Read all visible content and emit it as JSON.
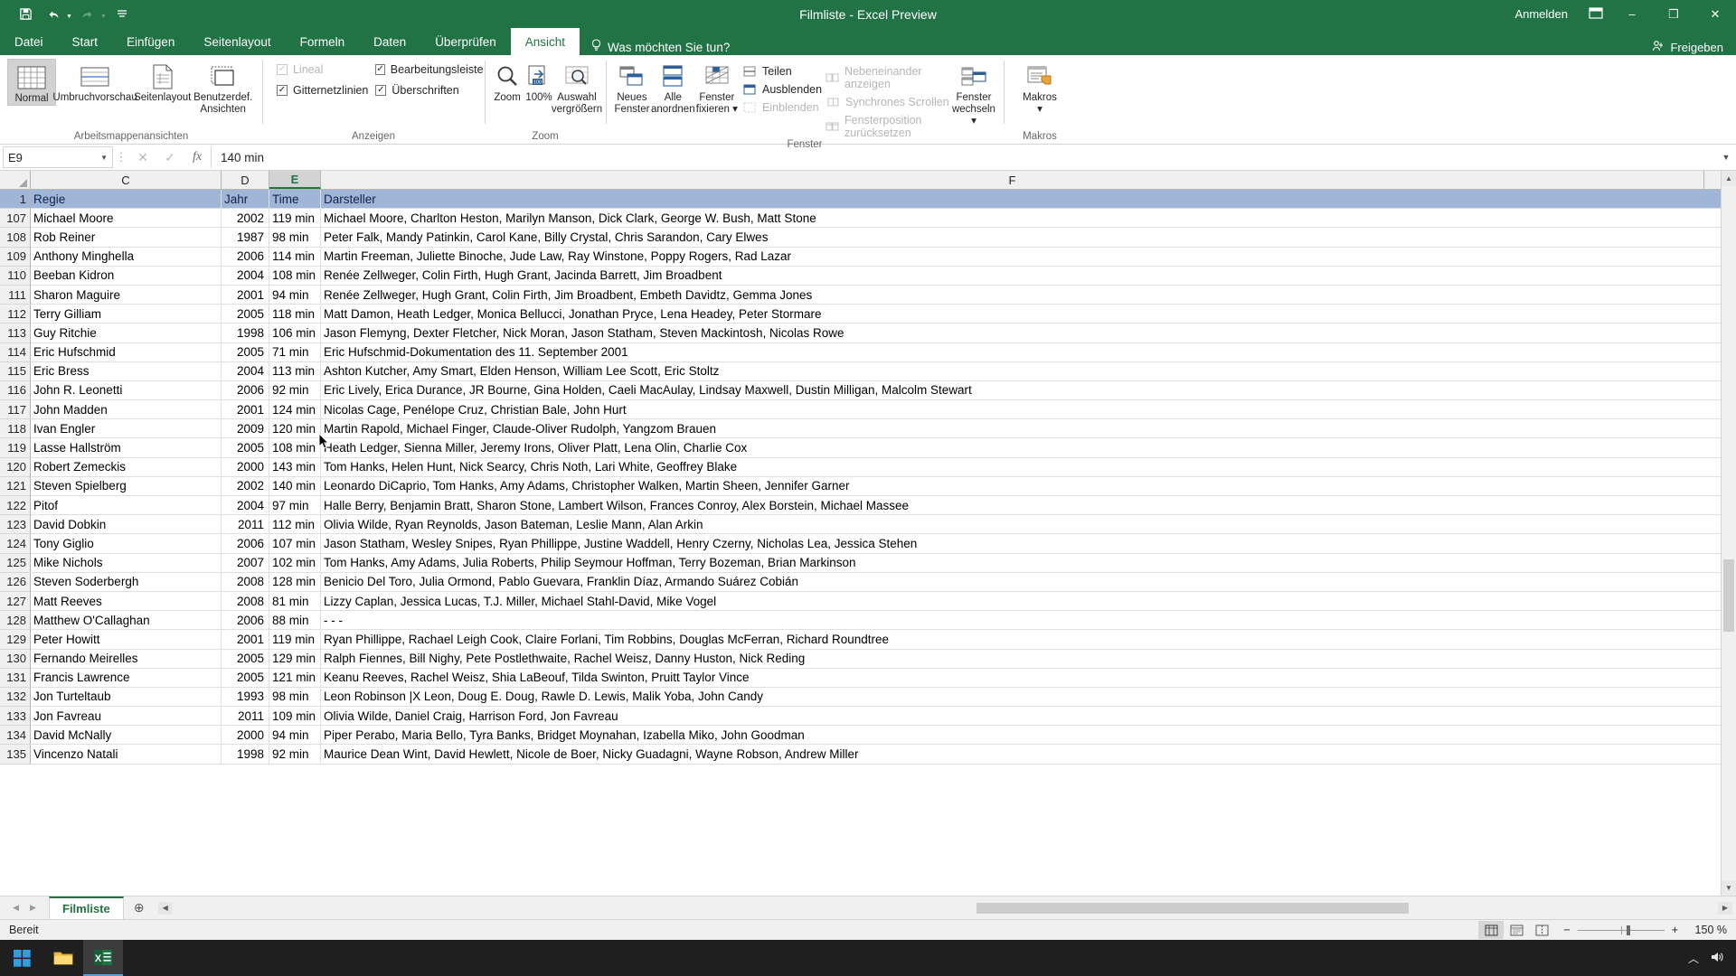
{
  "titlebar": {
    "document_title": "Filmliste - Excel Preview",
    "qat": [
      {
        "name": "save",
        "glyph": "ὋE"
      },
      {
        "name": "undo",
        "glyph": "↶"
      },
      {
        "name": "redo",
        "glyph": "↷"
      },
      {
        "name": "customize",
        "glyph": "≡"
      }
    ],
    "signin_label": "Anmelden",
    "ribbon_display_label": "□",
    "minimize_label": "–",
    "restore_label": "❐",
    "close_label": "✕"
  },
  "tabs": [
    {
      "id": "datei",
      "label": "Datei",
      "active": false
    },
    {
      "id": "start",
      "label": "Start",
      "active": false
    },
    {
      "id": "einfuegen",
      "label": "Einfügen",
      "active": false
    },
    {
      "id": "seitenlayout",
      "label": "Seitenlayout",
      "active": false
    },
    {
      "id": "formeln",
      "label": "Formeln",
      "active": false
    },
    {
      "id": "daten",
      "label": "Daten",
      "active": false
    },
    {
      "id": "ueberpruefen",
      "label": "Überprüfen",
      "active": false
    },
    {
      "id": "ansicht",
      "label": "Ansicht",
      "active": true
    }
  ],
  "tellme": {
    "label": "Was möchten Sie tun?",
    "icon": "lightbulb-icon"
  },
  "share": {
    "label": "Freigeben",
    "icon": "share-person-icon"
  },
  "ribbon": {
    "groups": [
      {
        "id": "arbeitsmappenansichten",
        "label": "Arbeitsmappenansichten",
        "buttons": [
          {
            "id": "normal",
            "label": "Normal",
            "selected": true
          },
          {
            "id": "umbruchvorschau",
            "label": "Umbruchvorschau",
            "selected": false
          },
          {
            "id": "seitenlayout",
            "label": "Seitenlayout",
            "selected": false
          },
          {
            "id": "benutzerdef_ansichten",
            "label": "Benutzerdef.\nAnsichten",
            "selected": false
          }
        ]
      },
      {
        "id": "anzeigen",
        "label": "Anzeigen",
        "checks": [
          {
            "id": "lineal",
            "label": "Lineal",
            "checked": true,
            "disabled": true
          },
          {
            "id": "bearbeitungsleiste",
            "label": "Bearbeitungsleiste",
            "checked": true,
            "disabled": false
          },
          {
            "id": "gitternetzlinien",
            "label": "Gitternetzlinien",
            "checked": true,
            "disabled": false
          },
          {
            "id": "ueberschriften",
            "label": "Überschriften",
            "checked": true,
            "disabled": false
          }
        ]
      },
      {
        "id": "zoom",
        "label": "Zoom",
        "buttons": [
          {
            "id": "zoom",
            "label": "Zoom",
            "selected": false
          },
          {
            "id": "hundert_prozent",
            "label": "100%",
            "selected": false
          },
          {
            "id": "auswahl_vergroessern",
            "label": "Auswahl\nvergrößern",
            "selected": false
          }
        ]
      },
      {
        "id": "fenster",
        "label": "Fenster",
        "buttons": [
          {
            "id": "neues_fenster",
            "label": "Neues\nFenster",
            "selected": false
          },
          {
            "id": "alle_anordnen",
            "label": "Alle\nanordnen",
            "selected": false
          },
          {
            "id": "fenster_fixieren",
            "label": "Fenster\nfixieren ▾",
            "selected": false
          }
        ],
        "checks": [
          {
            "id": "teilen",
            "label": "Teilen",
            "disabled": false
          },
          {
            "id": "ausblenden",
            "label": "Ausblenden",
            "disabled": false
          },
          {
            "id": "einblenden",
            "label": "Einblenden",
            "disabled": true
          }
        ],
        "small_items": [
          {
            "id": "nebeneinander_anzeigen",
            "label": "Nebeneinander anzeigen",
            "disabled": true
          },
          {
            "id": "synchrones_scrollen",
            "label": "Synchrones Scrollen",
            "disabled": true
          },
          {
            "id": "fensterposition_zuruecksetzen",
            "label": "Fensterposition zurücksetzen",
            "disabled": true
          }
        ],
        "end_buttons": [
          {
            "id": "fenster_wechseln",
            "label": "Fenster\nwechseln ▾",
            "selected": false
          }
        ]
      },
      {
        "id": "makros",
        "label": "Makros",
        "buttons": [
          {
            "id": "makros",
            "label": "Makros\n▾",
            "selected": false
          }
        ]
      }
    ]
  },
  "formula_bar": {
    "name_box_value": "E9",
    "cancel_icon": "cancel-icon",
    "confirm_icon": "check-icon",
    "fx_icon": "fx-icon",
    "formula_value": "140 min",
    "expand_icon": "chevron-down-icon"
  },
  "grid": {
    "columns": [
      {
        "id": "C",
        "label": "C",
        "selected": false
      },
      {
        "id": "D",
        "label": "D",
        "selected": false
      },
      {
        "id": "E",
        "label": "E",
        "selected": true
      },
      {
        "id": "F",
        "label": "F",
        "selected": false
      }
    ],
    "header_row": {
      "number": "1",
      "cells": [
        "Regie",
        "Jahr",
        "Time",
        "Darsteller"
      ]
    },
    "rows": [
      {
        "n": "107",
        "c": "Michael Moore",
        "d": "2002",
        "e": "119 min",
        "f": "Michael Moore, Charlton Heston, Marilyn Manson, Dick Clark, George W. Bush, Matt Stone"
      },
      {
        "n": "108",
        "c": "Rob Reiner",
        "d": "1987",
        "e": "98 min",
        "f": "Peter Falk, Mandy Patinkin, Carol Kane, Billy Crystal, Chris Sarandon, Cary Elwes"
      },
      {
        "n": "109",
        "c": "Anthony Minghella",
        "d": "2006",
        "e": "114 min",
        "f": "Martin Freeman, Juliette Binoche, Jude Law, Ray Winstone, Poppy Rogers, Rad Lazar"
      },
      {
        "n": "110",
        "c": "Beeban Kidron",
        "d": "2004",
        "e": "108 min",
        "f": "Renée Zellweger, Colin Firth, Hugh Grant, Jacinda Barrett, Jim Broadbent"
      },
      {
        "n": "111",
        "c": "Sharon Maguire",
        "d": "2001",
        "e": "94 min",
        "f": "Renée Zellweger, Hugh Grant, Colin Firth, Jim Broadbent, Embeth Davidtz, Gemma Jones"
      },
      {
        "n": "112",
        "c": "Terry Gilliam",
        "d": "2005",
        "e": "118 min",
        "f": "Matt Damon, Heath Ledger, Monica Bellucci, Jonathan Pryce, Lena Headey, Peter Stormare"
      },
      {
        "n": "113",
        "c": "Guy Ritchie",
        "d": "1998",
        "e": "106 min",
        "f": "Jason Flemyng, Dexter Fletcher, Nick Moran, Jason Statham, Steven Mackintosh, Nicolas Rowe"
      },
      {
        "n": "114",
        "c": "Eric Hufschmid",
        "d": "2005",
        "e": "71 min",
        "f": "Eric Hufschmid-Dokumentation des 11. September 2001"
      },
      {
        "n": "115",
        "c": "Eric Bress",
        "d": "2004",
        "e": "113 min",
        "f": "Ashton Kutcher, Amy Smart, Elden Henson, William Lee Scott, Eric Stoltz"
      },
      {
        "n": "116",
        "c": "John R. Leonetti",
        "d": "2006",
        "e": "92 min",
        "f": "Eric Lively, Erica Durance, JR Bourne, Gina Holden, Caeli MacAulay, Lindsay Maxwell, Dustin Milligan, Malcolm Stewart"
      },
      {
        "n": "117",
        "c": "John Madden",
        "d": "2001",
        "e": "124 min",
        "f": "Nicolas Cage, Penélope Cruz, Christian Bale, John Hurt"
      },
      {
        "n": "118",
        "c": "Ivan Engler",
        "d": "2009",
        "e": "120 min",
        "f": "Martin Rapold, Michael Finger, Claude-Oliver Rudolph, Yangzom Brauen"
      },
      {
        "n": "119",
        "c": "Lasse Hallström",
        "d": "2005",
        "e": "108 min",
        "f": "Heath Ledger, Sienna Miller, Jeremy Irons, Oliver Platt, Lena Olin, Charlie Cox"
      },
      {
        "n": "120",
        "c": "Robert Zemeckis",
        "d": "2000",
        "e": "143 min",
        "f": "Tom Hanks, Helen Hunt, Nick Searcy, Chris Noth, Lari White, Geoffrey Blake"
      },
      {
        "n": "121",
        "c": "Steven Spielberg",
        "d": "2002",
        "e": "140 min",
        "f": "Leonardo DiCaprio, Tom Hanks, Amy Adams, Christopher Walken, Martin Sheen, Jennifer Garner"
      },
      {
        "n": "122",
        "c": "Pitof",
        "d": "2004",
        "e": "97 min",
        "f": "Halle Berry, Benjamin Bratt, Sharon Stone, Lambert Wilson, Frances Conroy, Alex Borstein, Michael Massee"
      },
      {
        "n": "123",
        "c": "David Dobkin",
        "d": "2011",
        "e": "112 min",
        "f": "Olivia Wilde, Ryan Reynolds, Jason Bateman, Leslie Mann, Alan Arkin"
      },
      {
        "n": "124",
        "c": "Tony Giglio",
        "d": "2006",
        "e": "107 min",
        "f": "Jason Statham, Wesley Snipes, Ryan Phillippe, Justine Waddell, Henry Czerny, Nicholas Lea, Jessica Stehen"
      },
      {
        "n": "125",
        "c": "Mike Nichols",
        "d": "2007",
        "e": "102 min",
        "f": "Tom Hanks, Amy Adams, Julia Roberts, Philip Seymour Hoffman, Terry Bozeman, Brian Markinson"
      },
      {
        "n": "126",
        "c": "Steven Soderbergh",
        "d": "2008",
        "e": "128 min",
        "f": "Benicio Del Toro, Julia Ormond, Pablo Guevara, Franklin Díaz, Armando Suárez Cobián"
      },
      {
        "n": "127",
        "c": "Matt Reeves",
        "d": "2008",
        "e": "81 min",
        "f": "Lizzy Caplan, Jessica Lucas, T.J. Miller, Michael Stahl-David, Mike Vogel"
      },
      {
        "n": "128",
        "c": "Matthew O'Callaghan",
        "d": "2006",
        "e": "88 min",
        "f": "- - -"
      },
      {
        "n": "129",
        "c": "Peter Howitt",
        "d": "2001",
        "e": "119 min",
        "f": "Ryan Phillippe, Rachael Leigh Cook, Claire Forlani, Tim Robbins, Douglas McFerran, Richard Roundtree"
      },
      {
        "n": "130",
        "c": "Fernando Meirelles",
        "d": "2005",
        "e": "129 min",
        "f": "Ralph Fiennes, Bill Nighy, Pete Postlethwaite, Rachel Weisz, Danny Huston, Nick Reding"
      },
      {
        "n": "131",
        "c": "Francis Lawrence",
        "d": "2005",
        "e": "121 min",
        "f": "Keanu Reeves, Rachel Weisz, Shia LaBeouf, Tilda Swinton, Pruitt Taylor Vince"
      },
      {
        "n": "132",
        "c": "Jon Turteltaub",
        "d": "1993",
        "e": "98 min",
        "f": "Leon Robinson |X Leon, Doug E. Doug, Rawle D. Lewis, Malik Yoba, John Candy"
      },
      {
        "n": "133",
        "c": "Jon Favreau",
        "d": "2011",
        "e": "109 min",
        "f": "Olivia Wilde, Daniel Craig, Harrison Ford, Jon Favreau"
      },
      {
        "n": "134",
        "c": "David McNally",
        "d": "2000",
        "e": "94 min",
        "f": "Piper Perabo, Maria Bello, Tyra Banks, Bridget Moynahan, Izabella Miko, John Goodman"
      },
      {
        "n": "135",
        "c": "Vincenzo Natali",
        "d": "1998",
        "e": "92 min",
        "f": "Maurice Dean Wint, David Hewlett, Nicole de Boer, Nicky Guadagni, Wayne Robson, Andrew Miller"
      }
    ]
  },
  "sheetbar": {
    "first_icon": "nav-first-icon",
    "prev_icon": "nav-prev-icon",
    "next_icon": "nav-next-icon",
    "last_icon": "nav-last-icon",
    "sheets": [
      {
        "id": "filmliste",
        "label": "Filmliste",
        "active": true
      }
    ],
    "add_sheet_label": "⊕"
  },
  "statusbar": {
    "status_text": "Bereit",
    "view_buttons": [
      {
        "id": "normal-view",
        "name": "normal-view-icon",
        "active": true
      },
      {
        "id": "page-layout-view",
        "name": "page-layout-view-icon",
        "active": false
      },
      {
        "id": "page-break-view",
        "name": "page-break-view-icon",
        "active": false
      }
    ],
    "zoom_out_label": "−",
    "zoom_in_label": "+",
    "zoom_level": "150 %"
  },
  "taskbar": {
    "start_icon": "windows-start-icon",
    "apps": [
      {
        "id": "explorer",
        "name": "file-explorer-icon",
        "active": false
      },
      {
        "id": "excel",
        "name": "excel-icon",
        "active": true
      }
    ],
    "tray": [
      {
        "id": "show-hidden",
        "name": "chevron-up-icon",
        "label": "▲"
      },
      {
        "id": "volume",
        "name": "speaker-icon",
        "label": "🔊"
      }
    ]
  },
  "colors": {
    "excel_green": "#217346",
    "header_row_blue": "#9fb6d9",
    "selected_col": "#d3d3d3"
  }
}
